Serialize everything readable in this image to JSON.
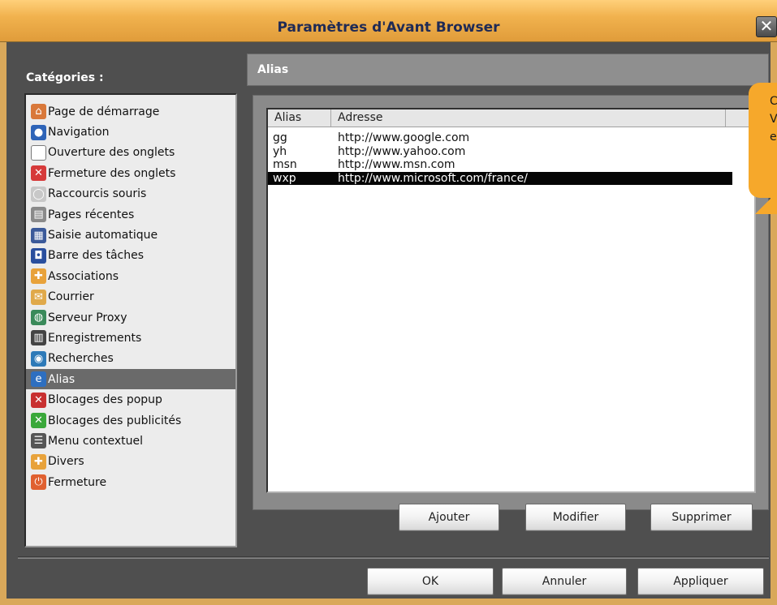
{
  "window": {
    "title": "Paramètres d'Avant Browser",
    "close_label": "✕"
  },
  "categories": {
    "title": "Catégories :",
    "items": [
      {
        "label": "Page de démarrage",
        "icon": "home-icon",
        "glyph": "⌂",
        "color": "#d9783a"
      },
      {
        "label": "Navigation",
        "icon": "globe-icon",
        "glyph": "●",
        "color": "#2e64b8"
      },
      {
        "label": "Ouverture des onglets",
        "icon": "new-tab-icon",
        "glyph": "",
        "color": "#ffffff"
      },
      {
        "label": "Fermeture des onglets",
        "icon": "close-tab-icon",
        "glyph": "✕",
        "color": "#d63a3a"
      },
      {
        "label": "Raccourcis souris",
        "icon": "mouse-icon",
        "glyph": "◯",
        "color": "#c8c8c8"
      },
      {
        "label": "Pages récentes",
        "icon": "recent-pages-icon",
        "glyph": "▤",
        "color": "#8a8a8a"
      },
      {
        "label": "Saisie automatique",
        "icon": "autofill-icon",
        "glyph": "▦",
        "color": "#3b5a9a"
      },
      {
        "label": "Barre des tâches",
        "icon": "taskbar-icon",
        "glyph": "◘",
        "color": "#2a4f9e"
      },
      {
        "label": "Associations",
        "icon": "associations-icon",
        "glyph": "✚",
        "color": "#e8a23a"
      },
      {
        "label": "Courrier",
        "icon": "mail-icon",
        "glyph": "✉",
        "color": "#e0a94a"
      },
      {
        "label": "Serveur Proxy",
        "icon": "proxy-icon",
        "glyph": "◍",
        "color": "#3a8a5a"
      },
      {
        "label": "Enregistrements",
        "icon": "trash-icon",
        "glyph": "▥",
        "color": "#444444"
      },
      {
        "label": "Recherches",
        "icon": "search-globe-icon",
        "glyph": "◉",
        "color": "#2e7ab8"
      },
      {
        "label": "Alias",
        "icon": "ie-icon",
        "glyph": "e",
        "color": "#2e6fc0"
      },
      {
        "label": "Blocages des popup",
        "icon": "popup-block-icon",
        "glyph": "✕",
        "color": "#c83030"
      },
      {
        "label": "Blocages des publicités",
        "icon": "ad-block-icon",
        "glyph": "✕",
        "color": "#3aa83a"
      },
      {
        "label": "Menu contextuel",
        "icon": "context-menu-icon",
        "glyph": "☰",
        "color": "#555555"
      },
      {
        "label": "Divers",
        "icon": "misc-icon",
        "glyph": "✚",
        "color": "#e8a23a"
      },
      {
        "label": "Fermeture",
        "icon": "power-icon",
        "glyph": "⏻",
        "color": "#e06030"
      }
    ],
    "selected_index": 13
  },
  "pane": {
    "title": "Alias",
    "columns": {
      "alias": "Alias",
      "address": "Adresse"
    },
    "rows": [
      {
        "alias": "gg",
        "address": "http://www.google.com"
      },
      {
        "alias": "yh",
        "address": "http://www.yahoo.com"
      },
      {
        "alias": "msn",
        "address": "http://www.msn.com"
      },
      {
        "alias": "wxp",
        "address": "http://www.microsoft.com/france/"
      }
    ],
    "selected_row": 3,
    "buttons": {
      "add": "Ajouter",
      "edit": "Modifier",
      "delete": "Supprimer"
    }
  },
  "footer": {
    "ok": "OK",
    "cancel": "Annuler",
    "apply": "Appliquer"
  },
  "callout": {
    "lines": [
      "C",
      "V",
      "e"
    ]
  },
  "colors": {
    "accent": "#f1b24e",
    "title_text": "#1f2a55",
    "callout": "#f6a82b",
    "selection": "#050505"
  }
}
